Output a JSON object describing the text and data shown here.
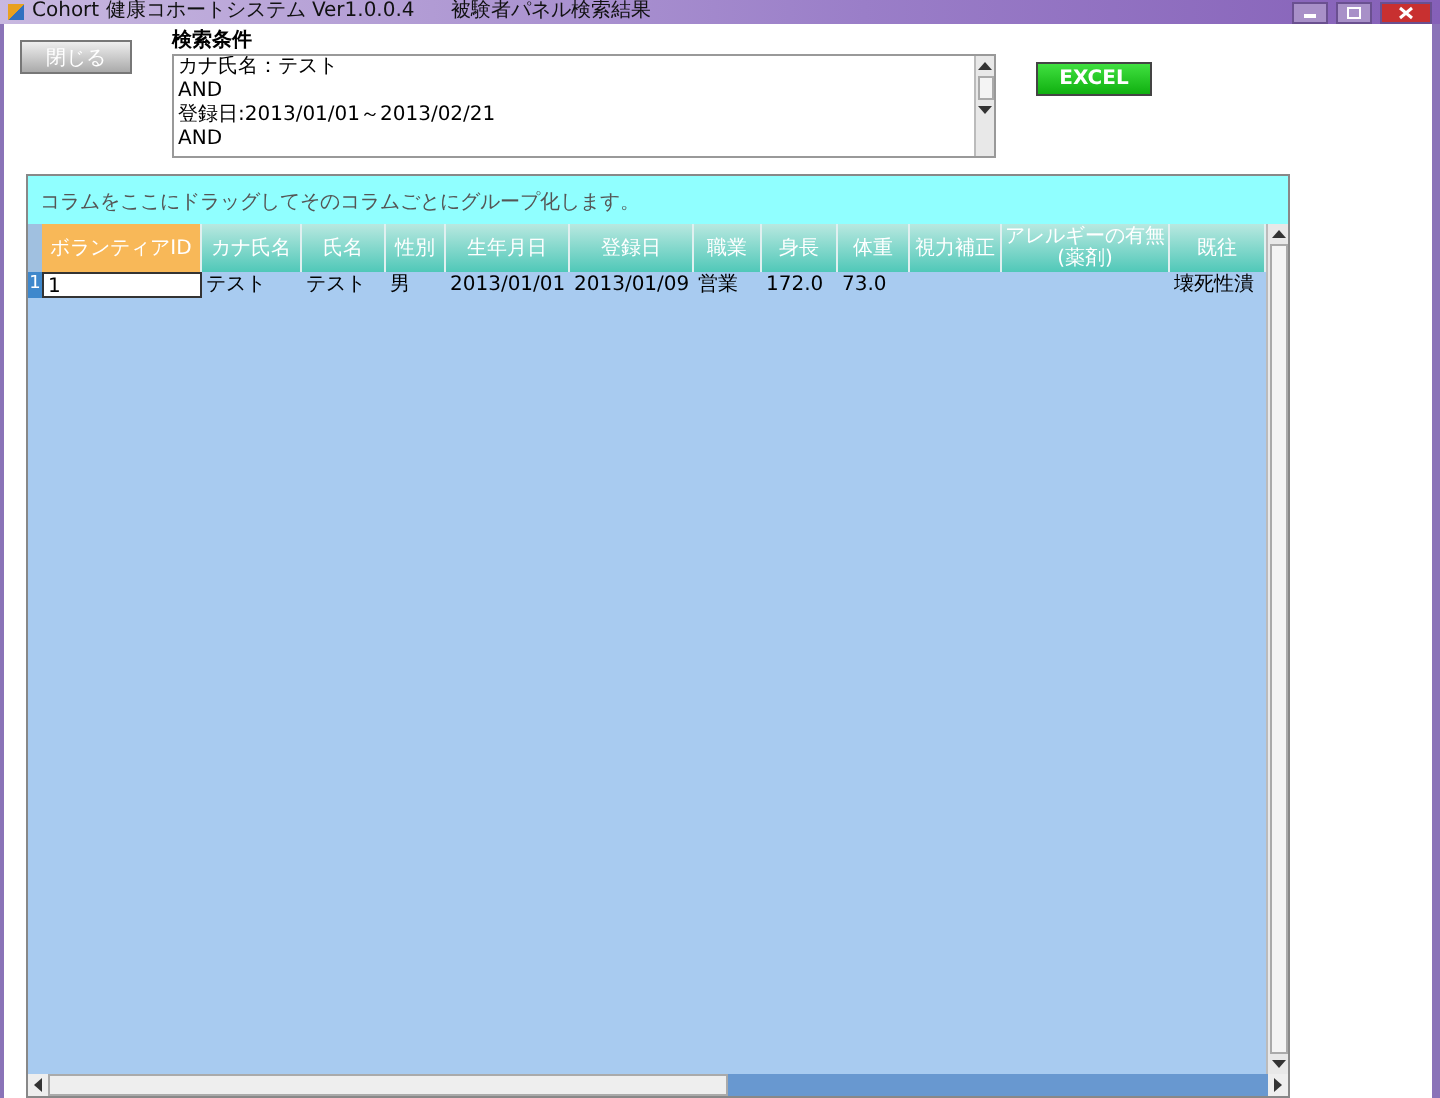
{
  "window": {
    "title": "Cohort 健康コホートシステム Ver1.0.0.4",
    "subtitle": "被験者パネル検索結果"
  },
  "close_button": "閉じる",
  "excel_button": "EXCEL",
  "search_conditions": {
    "label": "検索条件",
    "lines": [
      "カナ氏名：テスト",
      "AND",
      "登録日:2013/01/01～2013/02/21",
      "AND"
    ]
  },
  "grid": {
    "group_panel": "コラムをここにドラッグしてそのコラムごとにグループ化します。",
    "columns": [
      {
        "label": "ボランティアID",
        "selected": true
      },
      {
        "label": "カナ氏名",
        "selected": false
      },
      {
        "label": "氏名",
        "selected": false
      },
      {
        "label": "性別",
        "selected": false
      },
      {
        "label": "生年月日",
        "selected": false
      },
      {
        "label": "登録日",
        "selected": false
      },
      {
        "label": "職業",
        "selected": false
      },
      {
        "label": "身長",
        "selected": false
      },
      {
        "label": "体重",
        "selected": false
      },
      {
        "label": "視力補正",
        "selected": false
      },
      {
        "label": "アレルギーの有無(薬剤)",
        "selected": false
      },
      {
        "label": "既往",
        "selected": false
      }
    ],
    "rows": [
      {
        "row_number": "1",
        "selected": true,
        "cells": [
          "1",
          "テスト",
          "テスト",
          "男",
          "2013/01/01",
          "2013/01/09",
          "営業",
          "172.0",
          "73.0",
          null,
          null,
          "壊死性潰"
        ]
      }
    ]
  }
}
